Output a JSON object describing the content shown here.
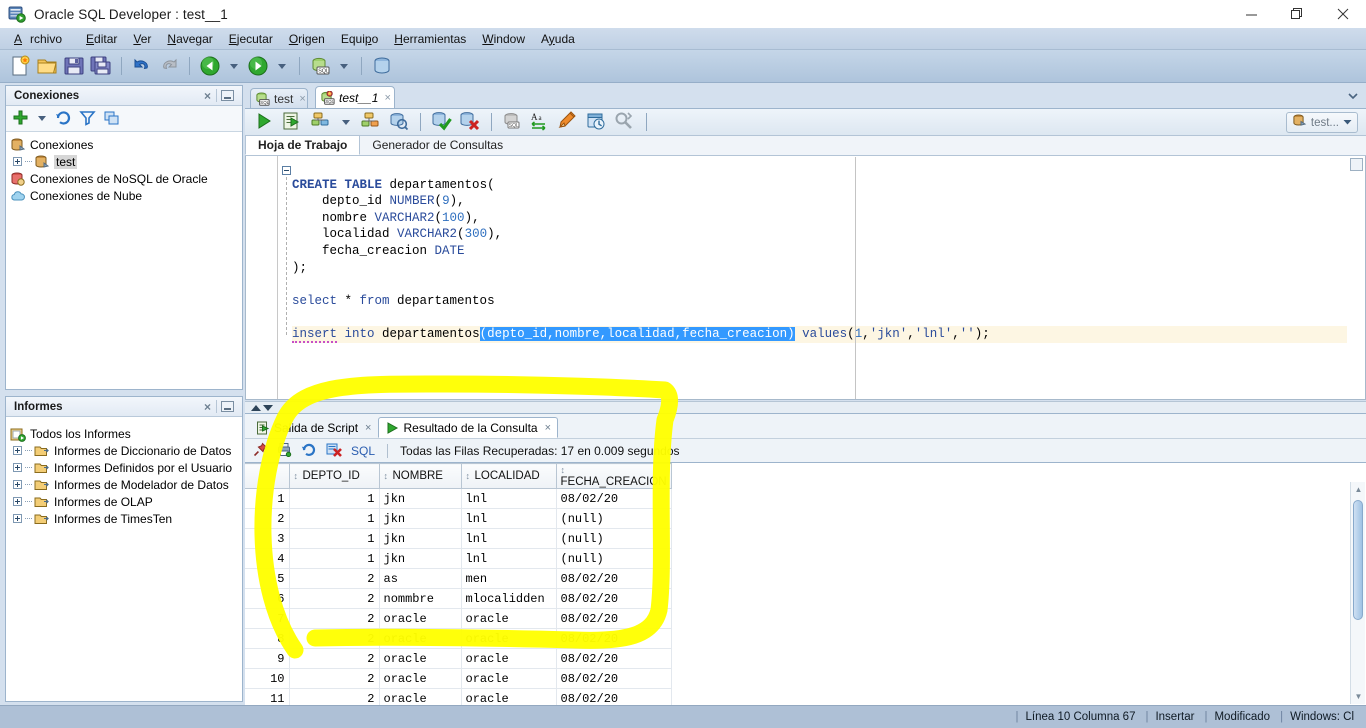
{
  "window": {
    "title": "Oracle SQL Developer : test__1",
    "icon": "sqldev-app-icon",
    "controls": {
      "minimize": "—",
      "maximize": "❐",
      "close": "✕"
    }
  },
  "menubar": {
    "items": [
      {
        "label": "Archivo",
        "mnemonic": "A"
      },
      {
        "label": "Editar",
        "mnemonic": "E"
      },
      {
        "label": "Ver",
        "mnemonic": "V"
      },
      {
        "label": "Navegar",
        "mnemonic": "N"
      },
      {
        "label": "Ejecutar",
        "mnemonic": "E"
      },
      {
        "label": "Origen",
        "mnemonic": "O"
      },
      {
        "label": "Equipo",
        "mnemonic": "p"
      },
      {
        "label": "Herramientas",
        "mnemonic": "H"
      },
      {
        "label": "Window",
        "mnemonic": "W"
      },
      {
        "label": "Ayuda",
        "mnemonic": "y"
      }
    ]
  },
  "main_toolbar": {
    "buttons": [
      {
        "name": "new-file-icon",
        "tip": "Nuevo"
      },
      {
        "name": "open-folder-icon",
        "tip": "Abrir"
      },
      {
        "name": "save-icon",
        "tip": "Guardar"
      },
      {
        "name": "save-all-icon",
        "tip": "Guardar Todo"
      },
      {
        "name": "undo-icon",
        "tip": "Deshacer"
      },
      {
        "name": "redo-icon",
        "tip": "Rehacer"
      },
      {
        "name": "back-icon",
        "tip": "Atras"
      },
      {
        "name": "forward-icon",
        "tip": "Adelante"
      },
      {
        "name": "sql-worksheet-icon",
        "tip": "Hoja de Trabajo SQL"
      },
      {
        "name": "database-icon",
        "tip": "Base de Datos"
      }
    ]
  },
  "connections_panel": {
    "title": "Conexiones",
    "toolbar": [
      {
        "name": "add-connection-icon"
      },
      {
        "name": "refresh-icon"
      },
      {
        "name": "filter-icon"
      },
      {
        "name": "collapse-all-icon"
      }
    ],
    "tree": [
      {
        "label": "Conexiones",
        "icon": "connections-root-icon",
        "level": 0,
        "expandable": false,
        "selected": false
      },
      {
        "label": "test",
        "icon": "connection-icon",
        "level": 1,
        "expandable": true,
        "selected": true
      },
      {
        "label": "Conexiones de NoSQL de Oracle",
        "icon": "nosql-icon",
        "level": 0,
        "expandable": false,
        "selected": false
      },
      {
        "label": "Conexiones de Nube",
        "icon": "cloud-icon",
        "level": 0,
        "expandable": false,
        "selected": false
      }
    ]
  },
  "reports_panel": {
    "title": "Informes",
    "tree": [
      {
        "label": "Todos los Informes",
        "icon": "all-reports-icon",
        "level": 0,
        "expandable": false
      },
      {
        "label": "Informes de Diccionario de Datos",
        "icon": "folder-report-icon",
        "level": 1,
        "expandable": true
      },
      {
        "label": "Informes Definidos por el Usuario",
        "icon": "folder-report-icon",
        "level": 1,
        "expandable": true
      },
      {
        "label": "Informes de Modelador de Datos",
        "icon": "folder-report-icon",
        "level": 1,
        "expandable": true
      },
      {
        "label": "Informes de OLAP",
        "icon": "folder-report-icon",
        "level": 1,
        "expandable": true
      },
      {
        "label": "Informes de TimesTen",
        "icon": "folder-report-icon",
        "level": 1,
        "expandable": true
      }
    ]
  },
  "editor_tabs": [
    {
      "label": "test",
      "icon": "worksheet-icon",
      "active": false,
      "closable": true
    },
    {
      "label": "test__1",
      "icon": "worksheet-modified-icon",
      "active": true,
      "closable": true
    }
  ],
  "worksheet_toolbar": {
    "buttons": [
      {
        "name": "run-statement-icon"
      },
      {
        "name": "run-script-icon"
      },
      {
        "name": "autotrace-icon"
      },
      {
        "name": "explain-plan-icon"
      },
      {
        "name": "sql-history-icon"
      },
      {
        "name": "commit-icon"
      },
      {
        "name": "rollback-icon"
      },
      {
        "name": "unshared-worksheet-icon"
      },
      {
        "name": "format-icon"
      },
      {
        "name": "clear-icon"
      },
      {
        "name": "query-builder-icon"
      },
      {
        "name": "find-icon"
      }
    ],
    "connection_selector": {
      "label": "test...",
      "icon": "connection-icon"
    }
  },
  "worksheet_subtabs": [
    {
      "label": "Hoja de Trabajo",
      "active": true
    },
    {
      "label": "Generador de Consultas",
      "active": false
    }
  ],
  "sql_editor": {
    "lines": [
      "CREATE TABLE departamentos(",
      "    depto_id NUMBER(9),",
      "    nombre VARCHAR2(100),",
      "    localidad VARCHAR2(300),",
      "    fecha_creacion DATE",
      ");",
      "",
      "select * from departamentos",
      "",
      "insert into departamentos(depto_id,nombre,localidad,fecha_creacion) values(1,'jkn','lnl','');"
    ],
    "selection_text": "(depto_id,nombre,localidad,fecha_creacion)",
    "current_line_index": 9
  },
  "results_panel": {
    "tabs": [
      {
        "label": "Salida de Script",
        "icon": "script-output-icon",
        "active": false,
        "closable": true
      },
      {
        "label": "Resultado de la Consulta",
        "icon": "query-result-icon",
        "active": true,
        "closable": true
      }
    ],
    "toolbar": [
      {
        "name": "pin-icon"
      },
      {
        "name": "print-icon"
      },
      {
        "name": "refresh-icon"
      },
      {
        "name": "cancel-icon"
      }
    ],
    "sql_label": "SQL",
    "status": "Todas las Filas Recuperadas: 17 en 0.009 segundos"
  },
  "result_grid": {
    "columns": [
      "DEPTO_ID",
      "NOMBRE",
      "LOCALIDAD",
      "FECHA_CREACION"
    ],
    "rows": [
      {
        "n": "1",
        "DEPTO_ID": "1",
        "NOMBRE": "jkn",
        "LOCALIDAD": "lnl",
        "FECHA_CREACION": "08/02/20"
      },
      {
        "n": "2",
        "DEPTO_ID": "1",
        "NOMBRE": "jkn",
        "LOCALIDAD": "lnl",
        "FECHA_CREACION": "(null)"
      },
      {
        "n": "3",
        "DEPTO_ID": "1",
        "NOMBRE": "jkn",
        "LOCALIDAD": "lnl",
        "FECHA_CREACION": "(null)"
      },
      {
        "n": "4",
        "DEPTO_ID": "1",
        "NOMBRE": "jkn",
        "LOCALIDAD": "lnl",
        "FECHA_CREACION": "(null)"
      },
      {
        "n": "5",
        "DEPTO_ID": "2",
        "NOMBRE": "as",
        "LOCALIDAD": "men",
        "FECHA_CREACION": "08/02/20"
      },
      {
        "n": "6",
        "DEPTO_ID": "2",
        "NOMBRE": "nommbre",
        "LOCALIDAD": "mlocalidden",
        "FECHA_CREACION": "08/02/20"
      },
      {
        "n": "7",
        "DEPTO_ID": "2",
        "NOMBRE": "oracle",
        "LOCALIDAD": "oracle",
        "FECHA_CREACION": "08/02/20"
      },
      {
        "n": "8",
        "DEPTO_ID": "2",
        "NOMBRE": "oracle",
        "LOCALIDAD": "oracle",
        "FECHA_CREACION": "08/02/20"
      },
      {
        "n": "9",
        "DEPTO_ID": "2",
        "NOMBRE": "oracle",
        "LOCALIDAD": "oracle",
        "FECHA_CREACION": "08/02/20"
      },
      {
        "n": "10",
        "DEPTO_ID": "2",
        "NOMBRE": "oracle",
        "LOCALIDAD": "oracle",
        "FECHA_CREACION": "08/02/20"
      },
      {
        "n": "11",
        "DEPTO_ID": "2",
        "NOMBRE": "oracle",
        "LOCALIDAD": "oracle",
        "FECHA_CREACION": "08/02/20"
      }
    ]
  },
  "status_bar": {
    "position": "Línea 10 Columna 67",
    "mode": "Insertar",
    "modified": "Modificado",
    "encoding": "Windows: Cl"
  },
  "annotation": {
    "kind": "handdrawn-highlight-oval",
    "color": "#ffff00"
  }
}
